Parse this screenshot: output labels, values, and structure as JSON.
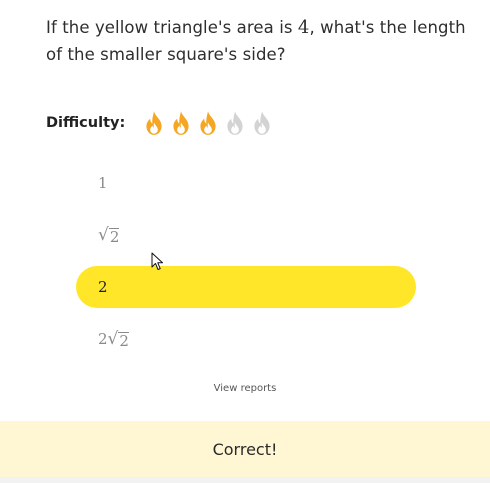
{
  "question": {
    "before": "If the yellow triangle's area is ",
    "math": "4",
    "after": ", what's the length of the smaller square's side?"
  },
  "difficulty": {
    "label": "Difficulty:",
    "level": 3,
    "max": 5,
    "active_color": "#f5a623",
    "inactive_color": "#d3d3d3"
  },
  "options": [
    {
      "prefix": "1",
      "radicand": "",
      "selected": false
    },
    {
      "prefix": "",
      "radicand": "2",
      "selected": false
    },
    {
      "prefix": "2",
      "radicand": "",
      "selected": true
    },
    {
      "prefix": "2",
      "radicand": "2",
      "selected": false
    }
  ],
  "selected_color": "#ffe629",
  "view_reports": "View reports",
  "feedback": {
    "text": "Correct!",
    "background": "#fff7d4"
  }
}
